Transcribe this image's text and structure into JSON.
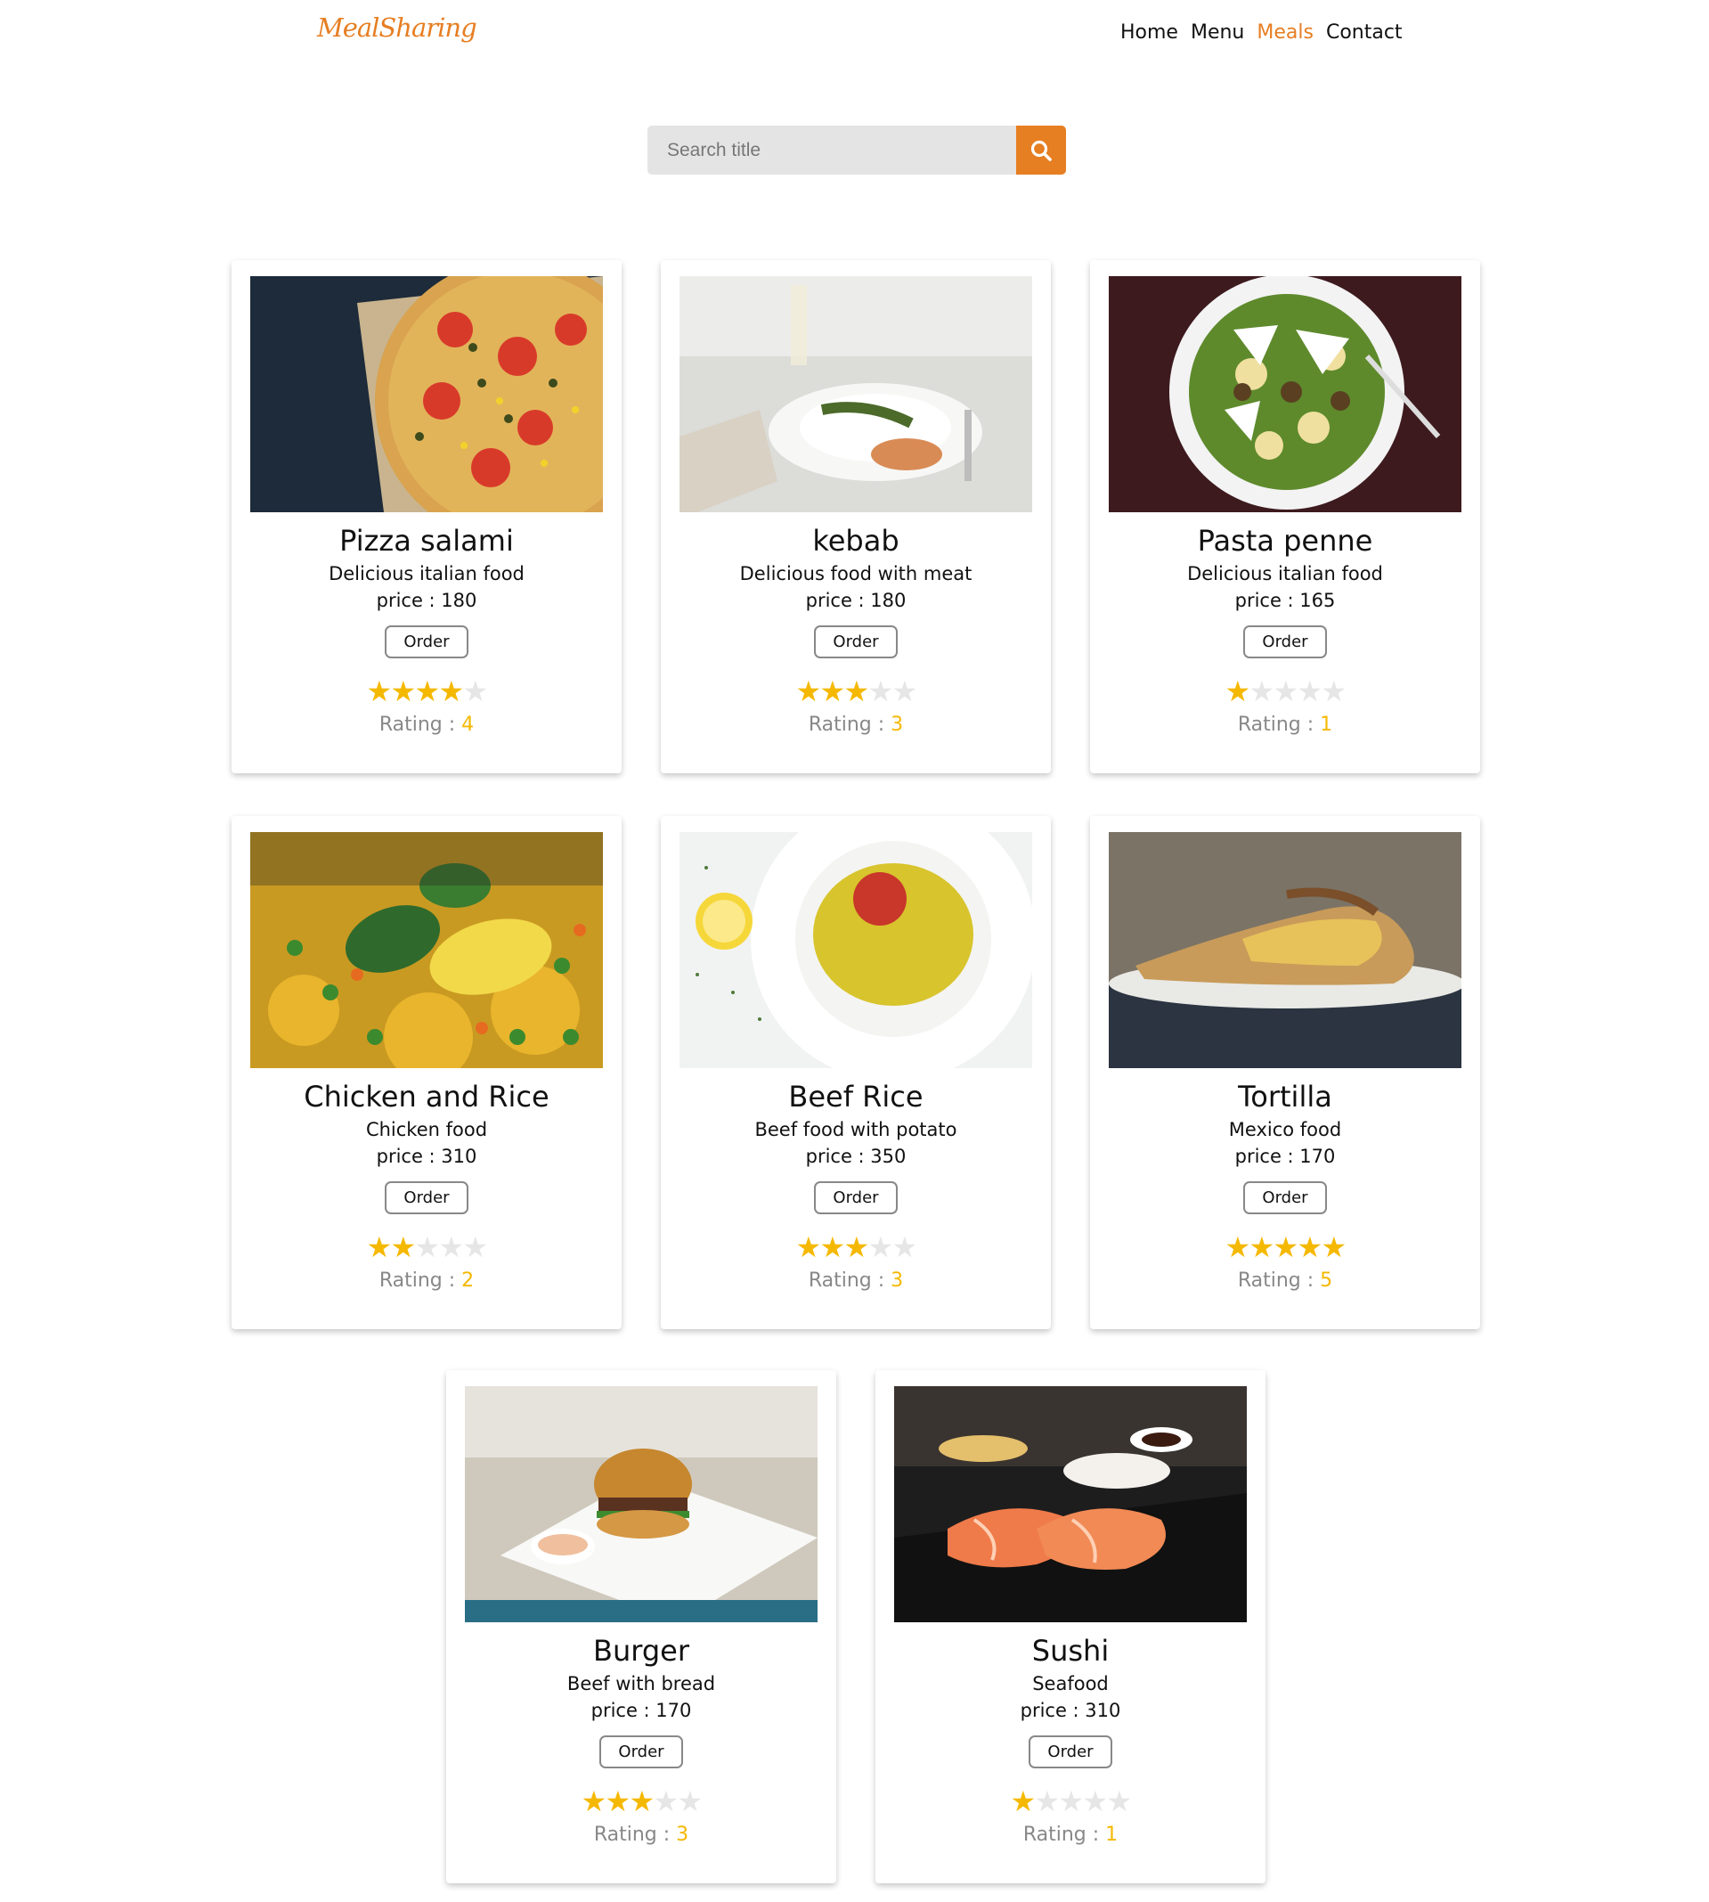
{
  "header": {
    "logo": "MealSharing",
    "nav": [
      "Home",
      "Menu",
      "Meals",
      "Contact"
    ],
    "active_nav": "Meals"
  },
  "search": {
    "placeholder": "Search title",
    "icon": "search-icon"
  },
  "colors": {
    "accent": "#e67e22",
    "star": "#f5b800",
    "star_off": "#e6e6e6"
  },
  "meals": [
    {
      "title": "Pizza salami",
      "description": "Delicious italian food",
      "price": "price : 180",
      "order_label": "Order",
      "rating_label": "Rating : ",
      "rating": 4,
      "image": "pizza"
    },
    {
      "title": "kebab",
      "description": "Delicious food with meat",
      "price": "price : 180",
      "order_label": "Order",
      "rating_label": "Rating : ",
      "rating": 3,
      "image": "kebab"
    },
    {
      "title": "Pasta penne",
      "description": "Delicious italian food",
      "price": "price : 165",
      "order_label": "Order",
      "rating_label": "Rating : ",
      "rating": 1,
      "image": "pasta"
    },
    {
      "title": "Chicken and Rice",
      "description": "Chicken food",
      "price": "price : 310",
      "order_label": "Order",
      "rating_label": "Rating : ",
      "rating": 2,
      "image": "rice"
    },
    {
      "title": "Beef Rice",
      "description": "Beef food with potato",
      "price": "price : 350",
      "order_label": "Order",
      "rating_label": "Rating : ",
      "rating": 3,
      "image": "beefrice"
    },
    {
      "title": "Tortilla",
      "description": "Mexico food",
      "price": "price : 170",
      "order_label": "Order",
      "rating_label": "Rating : ",
      "rating": 5,
      "image": "tortilla"
    },
    {
      "title": "Burger",
      "description": "Beef with bread",
      "price": "price : 170",
      "order_label": "Order",
      "rating_label": "Rating : ",
      "rating": 3,
      "image": "burger"
    },
    {
      "title": "Sushi",
      "description": "Seafood",
      "price": "price : 310",
      "order_label": "Order",
      "rating_label": "Rating : ",
      "rating": 1,
      "image": "sushi"
    }
  ]
}
